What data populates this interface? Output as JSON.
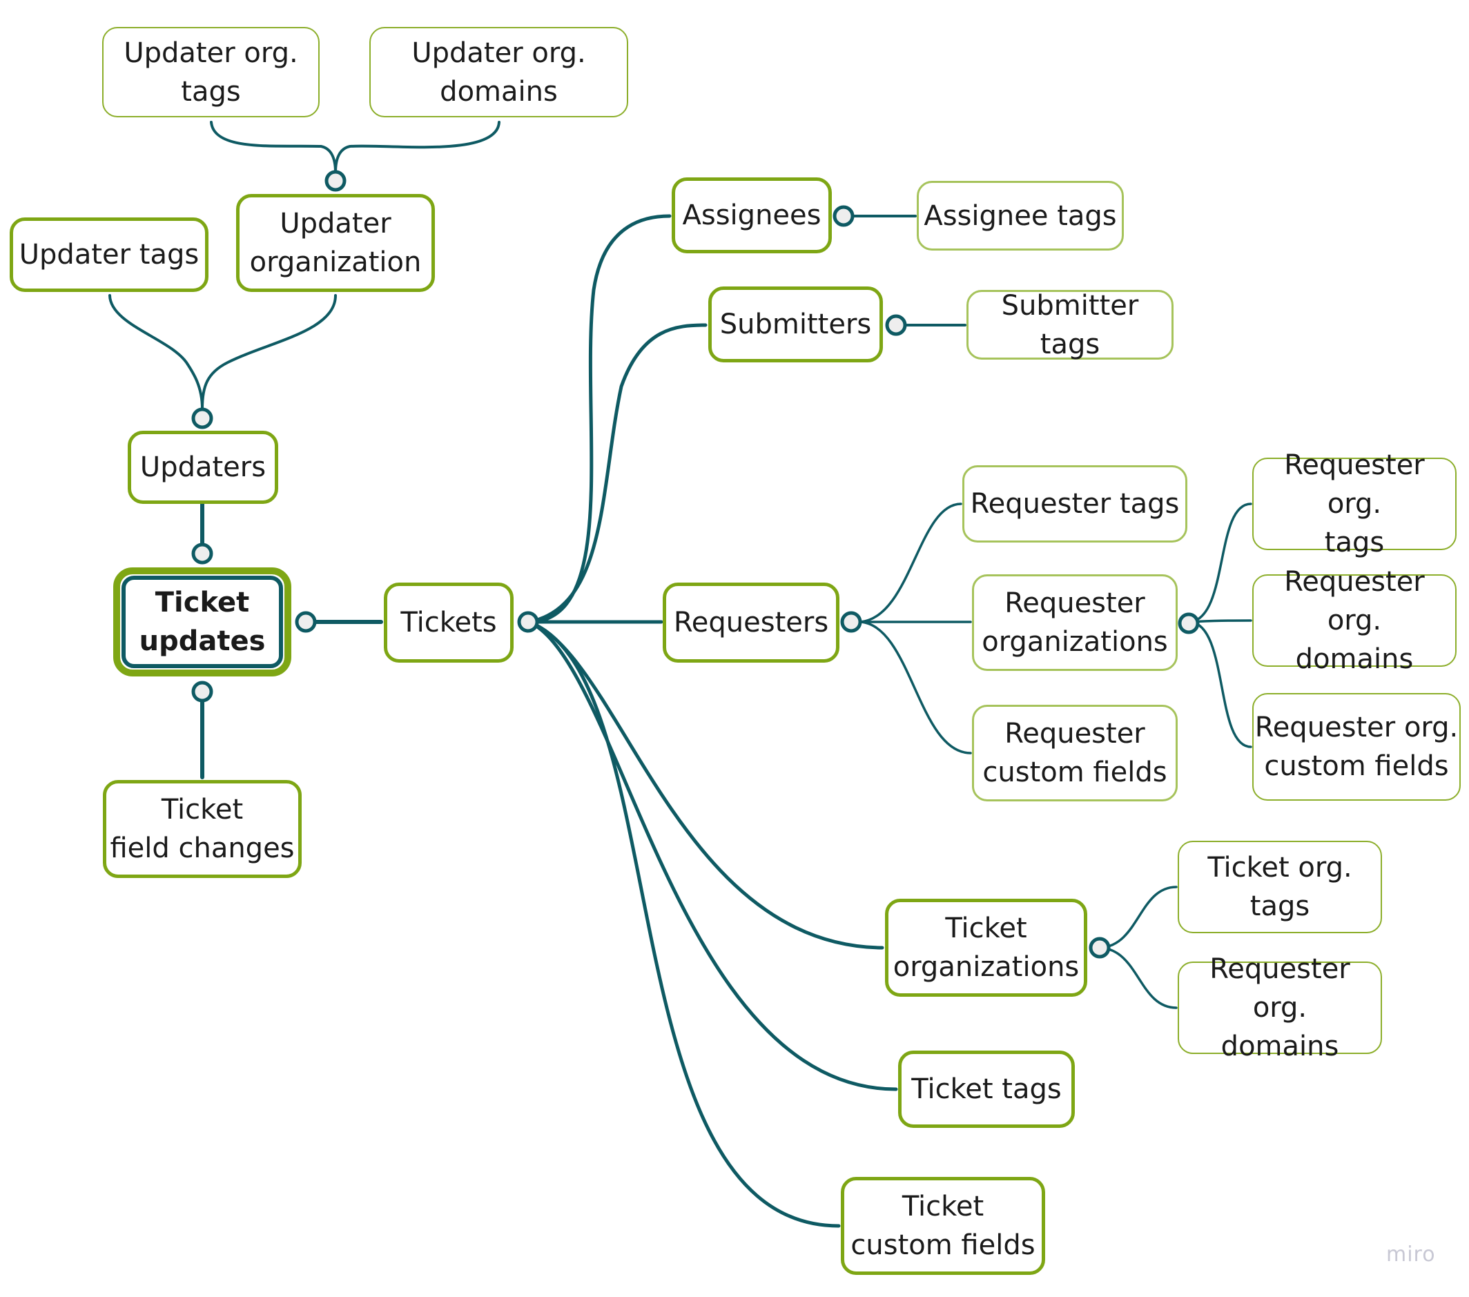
{
  "diagram": {
    "type": "mind-map",
    "colors": {
      "connector": "#0e5a63",
      "branch_border": "#7ea614",
      "leaf_border": "#a6c35b",
      "root_inner_border": "#0e5a63",
      "knob_fill": "#eeeeee"
    },
    "root": {
      "id": "ticket-updates",
      "label": "Ticket\nupdates"
    },
    "nodes": [
      {
        "id": "updaters",
        "label": "Updaters",
        "parent": "ticket-updates"
      },
      {
        "id": "updater-tags",
        "label": "Updater tags",
        "parent": "updaters"
      },
      {
        "id": "updater-organization",
        "label": "Updater\norganization",
        "parent": "updaters"
      },
      {
        "id": "updater-org-tags",
        "label": "Updater org.\ntags",
        "parent": "updater-organization"
      },
      {
        "id": "updater-org-domains",
        "label": "Updater org.\ndomains",
        "parent": "updater-organization"
      },
      {
        "id": "ticket-field-changes",
        "label": "Ticket\nfield changes",
        "parent": "ticket-updates"
      },
      {
        "id": "tickets",
        "label": "Tickets",
        "parent": "ticket-updates"
      },
      {
        "id": "assignees",
        "label": "Assignees",
        "parent": "tickets"
      },
      {
        "id": "assignee-tags",
        "label": "Assignee tags",
        "parent": "assignees"
      },
      {
        "id": "submitters",
        "label": "Submitters",
        "parent": "tickets"
      },
      {
        "id": "submitter-tags",
        "label": "Submitter tags",
        "parent": "submitters"
      },
      {
        "id": "requesters",
        "label": "Requesters",
        "parent": "tickets"
      },
      {
        "id": "requester-tags",
        "label": "Requester tags",
        "parent": "requesters"
      },
      {
        "id": "requester-organizations",
        "label": "Requester\norganizations",
        "parent": "requesters"
      },
      {
        "id": "requester-custom-fields",
        "label": "Requester\ncustom fields",
        "parent": "requesters"
      },
      {
        "id": "requester-org-tags",
        "label": "Requester org.\ntags",
        "parent": "requester-organizations"
      },
      {
        "id": "requester-org-domains",
        "label": "Requester org.\ndomains",
        "parent": "requester-organizations"
      },
      {
        "id": "requester-org-custom-fields",
        "label": "Requester org.\ncustom fields",
        "parent": "requester-organizations"
      },
      {
        "id": "ticket-organizations",
        "label": "Ticket\norganizations",
        "parent": "tickets"
      },
      {
        "id": "ticket-org-tags",
        "label": "Ticket org.\ntags",
        "parent": "ticket-organizations"
      },
      {
        "id": "ticket-org-requester-org-domains",
        "label": "Requester org.\ndomains",
        "parent": "ticket-organizations"
      },
      {
        "id": "ticket-tags",
        "label": "Ticket tags",
        "parent": "tickets"
      },
      {
        "id": "ticket-custom-fields",
        "label": "Ticket\ncustom fields",
        "parent": "tickets"
      }
    ]
  },
  "watermark": "miro"
}
